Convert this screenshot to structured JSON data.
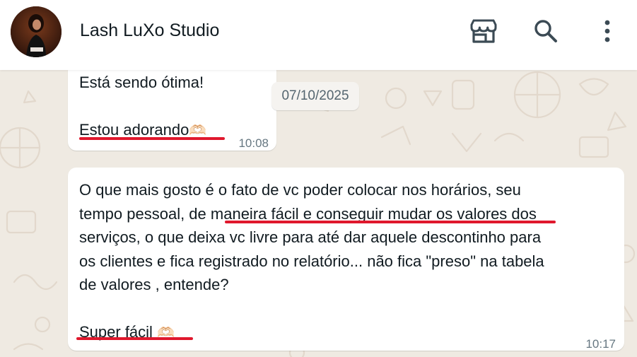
{
  "header": {
    "contact_name": "Lash LuXo Studio",
    "icons": [
      "store-icon",
      "search-icon",
      "more-vertical-icon"
    ]
  },
  "date_chip": "07/10/2025",
  "messages": [
    {
      "lines": [
        "Está sendo ótima!",
        "",
        "Estou adorando"
      ],
      "emoji": "🫶🏻",
      "time": "10:08"
    },
    {
      "lines": [
        "O que mais gosto é o fato de vc poder colocar nos horários,  seu",
        "tempo pessoal, de maneira fácil e conseguir mudar os valores dos",
        "serviços,  o que deixa vc livre para até dar aquele descontinho para",
        "os clientes e fica registrado no relatório... não fica \"preso\" na tabela",
        "de valores , entende?",
        "",
        "Super fácil"
      ],
      "emoji": "🫶🏻",
      "time": "10:17"
    }
  ],
  "colors": {
    "header_bg": "#ffffff",
    "chat_bg": "#efeae2",
    "bubble_bg": "#ffffff",
    "highlight_underline": "#e0182d",
    "text": "#111b21",
    "meta_text": "#667781"
  }
}
